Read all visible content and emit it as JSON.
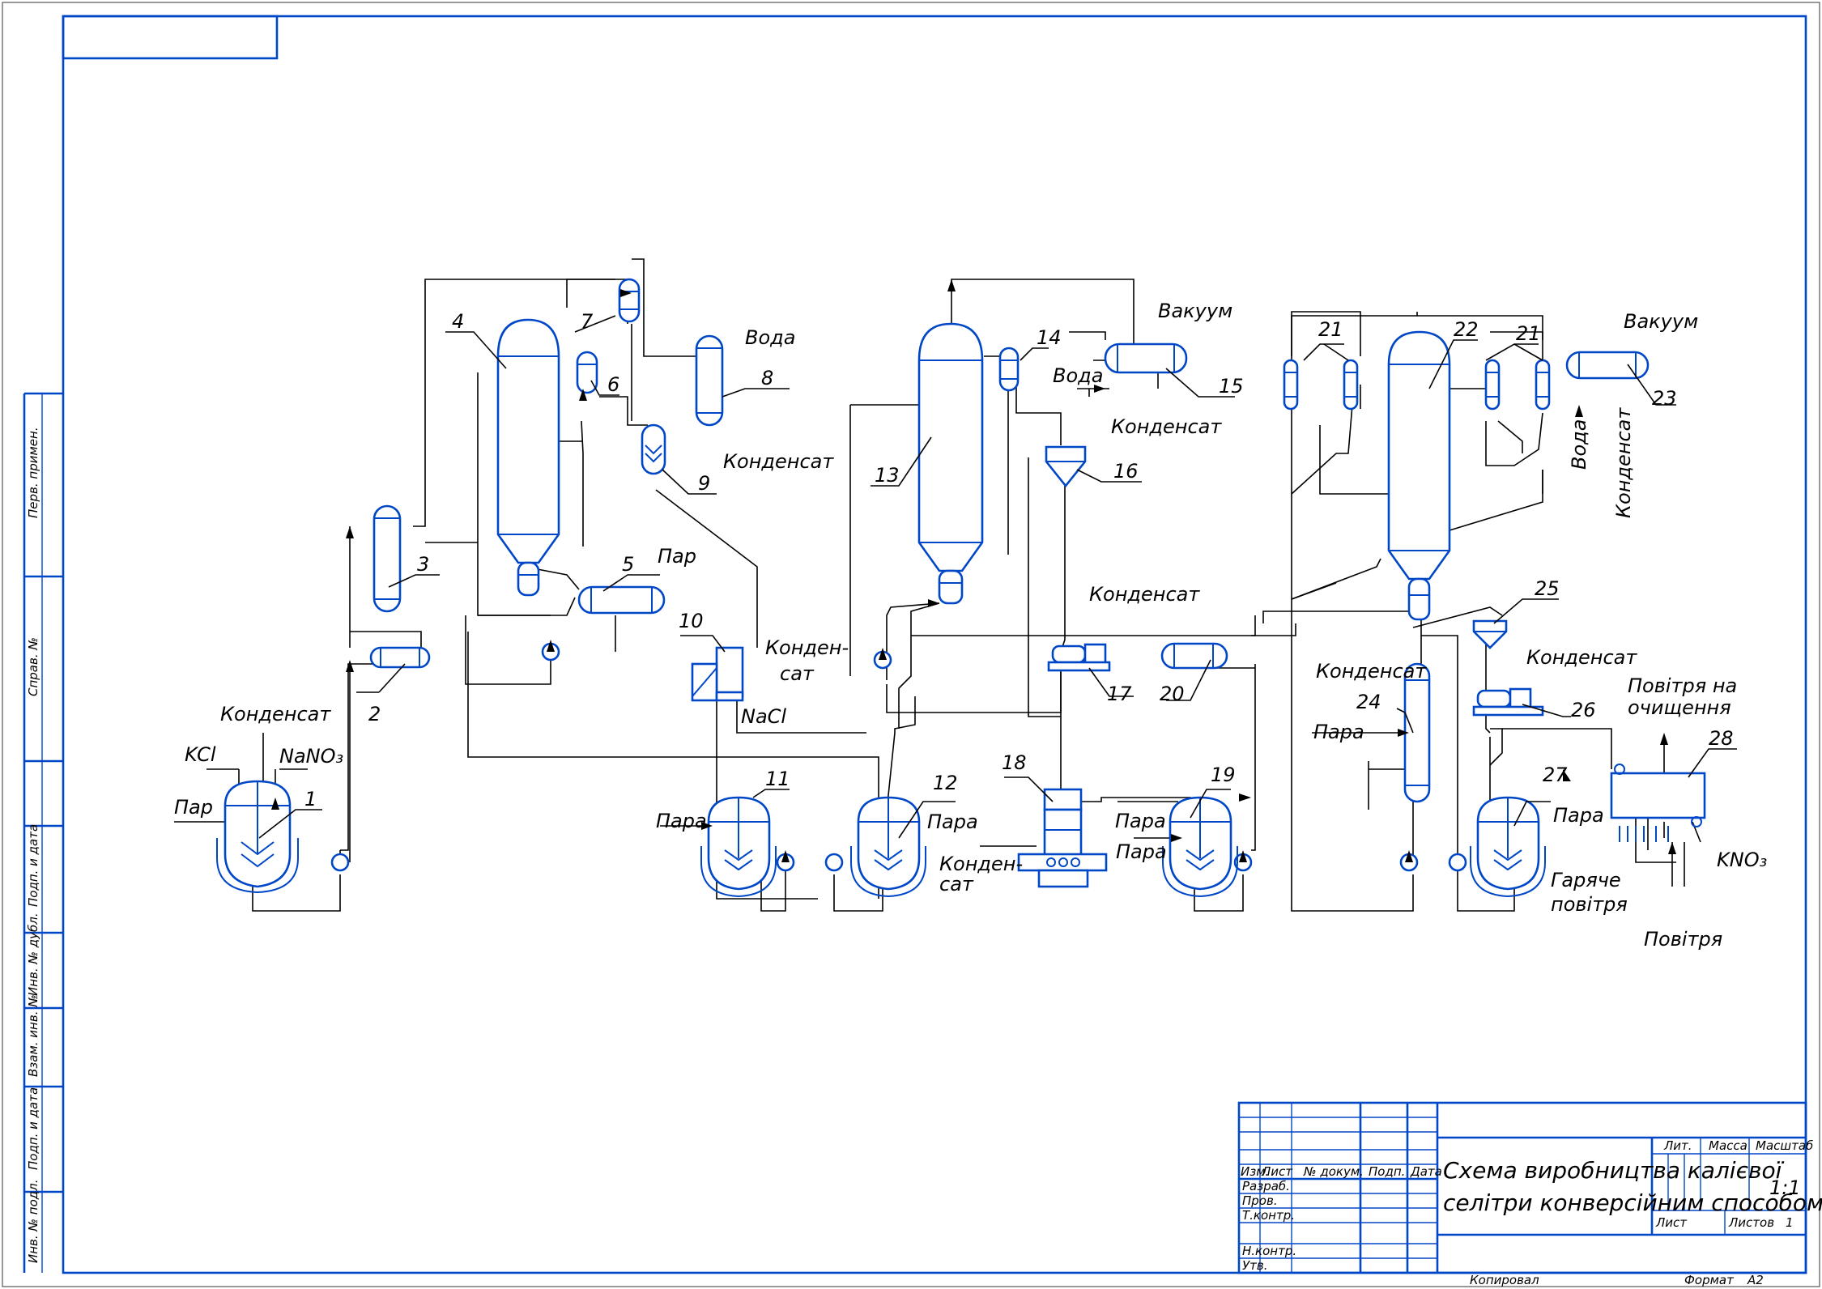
{
  "drawing_title": "Схема виробництва калієвої селітри конверсійним способом",
  "equipment_numbers": [
    "1",
    "2",
    "3",
    "4",
    "5",
    "6",
    "7",
    "8",
    "9",
    "10",
    "11",
    "12",
    "13",
    "14",
    "15",
    "16",
    "17",
    "18",
    "19",
    "20",
    "21",
    "21",
    "22",
    "23",
    "24",
    "25",
    "26",
    "27",
    "28"
  ],
  "stream_labels": {
    "kcl": "KCl",
    "nano3": "NaNO₃",
    "condensate_1": "Конденсат",
    "steam_1": "Пар",
    "water_8": "Вода",
    "condensate_8": "Конденсат",
    "steam_5": "Пар",
    "condensate_10a": "Конден-",
    "condensate_10b": "сат",
    "nacl": "NaCl",
    "steam_11": "Пара",
    "steam_12": "Пара",
    "vacuum_15": "Вакуум",
    "water_15": "Вода",
    "condensate_15": "Конденсат",
    "condensate_17": "Конденсат",
    "condensate_18a": "Конден-",
    "condensate_18b": "сат",
    "steam_19a": "Пара",
    "steam_19b": "Пара",
    "vacuum_23": "Вакуум",
    "water_23": "Вода",
    "condensate_23": "Конденсат",
    "condensate_24": "Конденсат",
    "steam_24": "Пара",
    "condensate_26": "Конденсат",
    "air_cleaning_a": "Повітря на",
    "air_cleaning_b": "очищення",
    "steam_27": "Пара",
    "hot_air_a": "Гаряче",
    "hot_air_b": "повітря",
    "air": "Повітря",
    "kno3": "KNO₃"
  },
  "side_stamp": [
    "Перв. примен.",
    "Справ. №",
    "Подп. и дата",
    "Инв. № дубл.",
    "Взам. инв. №",
    "Подп. и дата",
    "Инв. № подл."
  ],
  "title_block": {
    "col_izm": "Изм.",
    "col_list": "Лист",
    "col_doc": "№ докум.",
    "col_sign": "Подп.",
    "col_date": "Дата",
    "row_razrab": "Разраб.",
    "row_prov": "Пров.",
    "row_tkontr": "Т.контр.",
    "row_nkontr": "Н.контр.",
    "row_utv": "Утв.",
    "title_line1": "Схема виробництва калієвої",
    "title_line2": "селітри конверсійним способом",
    "lit": "Лит.",
    "massa": "Масса",
    "masshtab": "Масштаб",
    "scale": "1:1",
    "sheet": "Лист",
    "sheets": "Листов",
    "sheets_count": "1",
    "copied": "Копировал",
    "format": "Формат",
    "format_value": "А2"
  },
  "colors": {
    "equipment": "#0047c8",
    "lines": "#000000",
    "background": "#ffffff"
  }
}
